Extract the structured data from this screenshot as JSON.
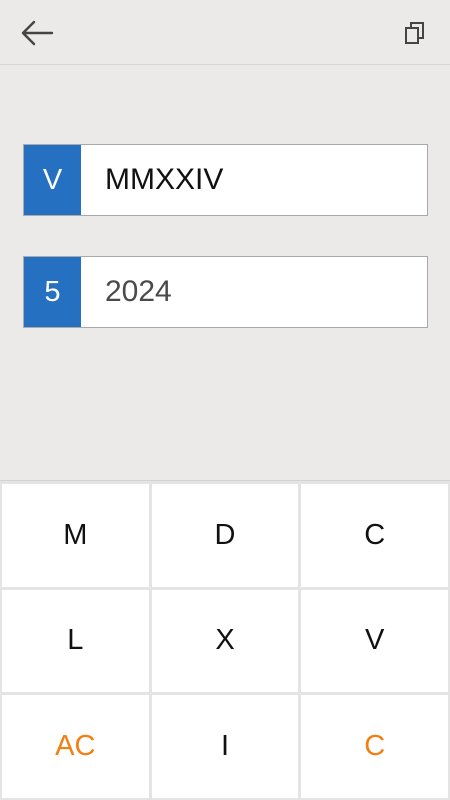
{
  "header": {
    "back_icon": "arrow-left-icon",
    "copy_icon": "copy-icon"
  },
  "roman_row": {
    "mode": "V",
    "value": "MMXXIV"
  },
  "arabic_row": {
    "mode": "5",
    "value": "2024"
  },
  "keypad": {
    "keys": [
      "M",
      "D",
      "C",
      "L",
      "X",
      "V",
      "AC",
      "I",
      "C"
    ]
  },
  "colors": {
    "mode_badge": "#2670c2",
    "accent_key": "#f27f12",
    "background": "#ebeae8"
  }
}
